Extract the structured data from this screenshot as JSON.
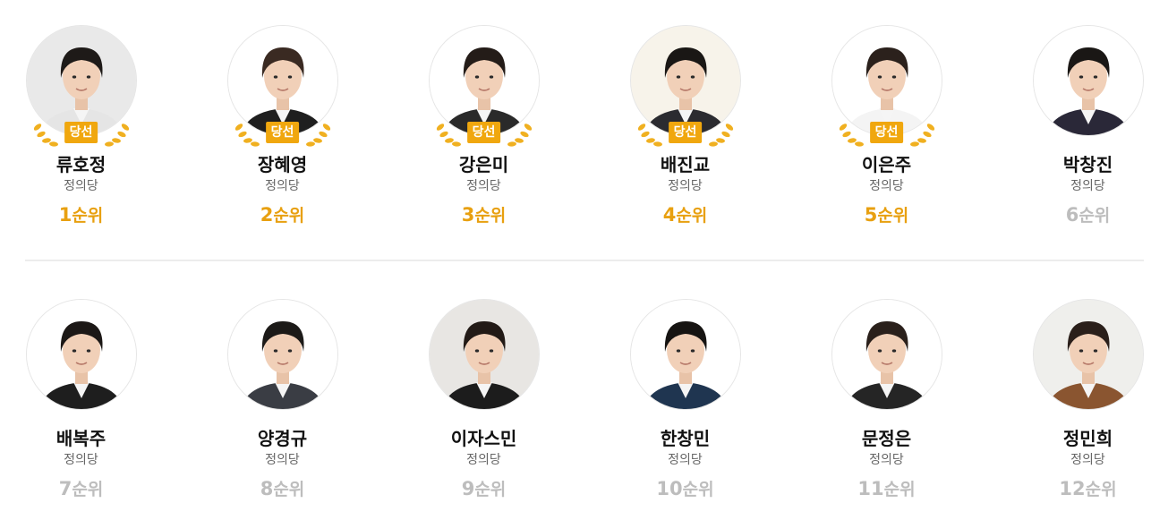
{
  "elected_badge_label": "당선",
  "rank_suffix": "순위",
  "colors": {
    "elected": "#e8a010",
    "not_elected": "#bdbdbd",
    "badge": "#f0a70e"
  },
  "rows": [
    [
      {
        "name": "류호정",
        "party": "정의당",
        "rank": "1",
        "elected": true,
        "photo_bg": "#e9e9e9",
        "suit": "#e5e5e5",
        "hair": "#1e1a18"
      },
      {
        "name": "장혜영",
        "party": "정의당",
        "rank": "2",
        "elected": true,
        "photo_bg": "#ffffff",
        "suit": "#1f1f1f",
        "hair": "#3a2a22"
      },
      {
        "name": "강은미",
        "party": "정의당",
        "rank": "3",
        "elected": true,
        "photo_bg": "#ffffff",
        "suit": "#2a2a2a",
        "hair": "#241c18"
      },
      {
        "name": "배진교",
        "party": "정의당",
        "rank": "4",
        "elected": true,
        "photo_bg": "#f7f3ea",
        "suit": "#2b2b30",
        "hair": "#1a1715"
      },
      {
        "name": "이은주",
        "party": "정의당",
        "rank": "5",
        "elected": true,
        "photo_bg": "#ffffff",
        "suit": "#f4f4f4",
        "hair": "#2b211c"
      },
      {
        "name": "박창진",
        "party": "정의당",
        "rank": "6",
        "elected": false,
        "photo_bg": "#ffffff",
        "suit": "#2a2838",
        "hair": "#1a1715"
      }
    ],
    [
      {
        "name": "배복주",
        "party": "정의당",
        "rank": "7",
        "elected": false,
        "photo_bg": "#ffffff",
        "suit": "#1e1e1e",
        "hair": "#1c1816"
      },
      {
        "name": "양경규",
        "party": "정의당",
        "rank": "8",
        "elected": false,
        "photo_bg": "#ffffff",
        "suit": "#3a3d44",
        "hair": "#1c1a18"
      },
      {
        "name": "이자스민",
        "party": "정의당",
        "rank": "9",
        "elected": false,
        "photo_bg": "#e8e6e3",
        "suit": "#1c1c1c",
        "hair": "#221a16"
      },
      {
        "name": "한창민",
        "party": "정의당",
        "rank": "10",
        "elected": false,
        "photo_bg": "#ffffff",
        "suit": "#1f3550",
        "hair": "#161412"
      },
      {
        "name": "문정은",
        "party": "정의당",
        "rank": "11",
        "elected": false,
        "photo_bg": "#ffffff",
        "suit": "#252525",
        "hair": "#2a201b"
      },
      {
        "name": "정민희",
        "party": "정의당",
        "rank": "12",
        "elected": false,
        "photo_bg": "#efefec",
        "suit": "#8a5530",
        "hair": "#2a1f1a"
      }
    ]
  ]
}
